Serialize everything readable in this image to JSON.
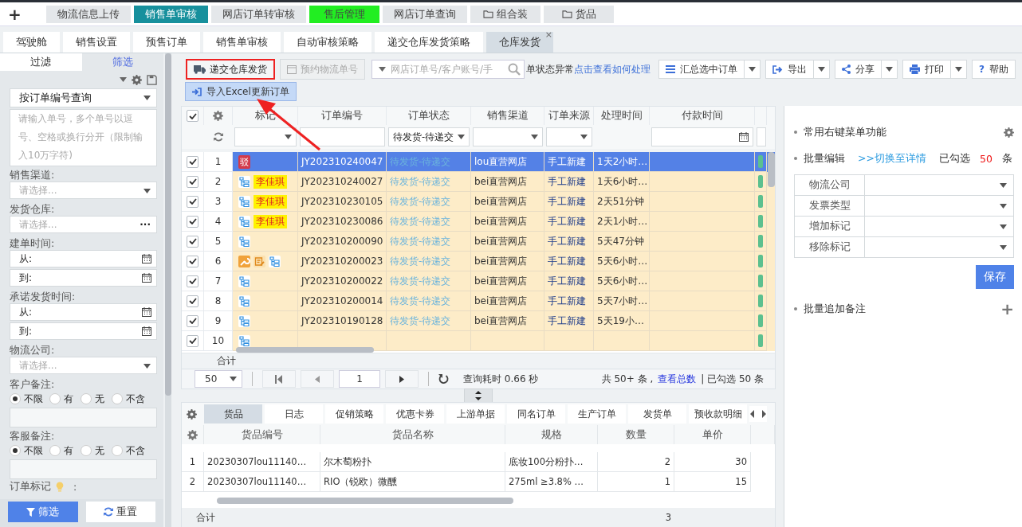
{
  "top_nav": {
    "add_icon": "+",
    "items": [
      {
        "label": "物流信息上传",
        "kind": "tab",
        "selected": false,
        "color": "#e4e7ea"
      },
      {
        "label": "销售单审核",
        "kind": "tab",
        "selected": true,
        "color": "#17909d"
      },
      {
        "label": "网店订单转审核",
        "kind": "tab",
        "selected": false,
        "color": "#e4e7ea"
      },
      {
        "label": "售后管理",
        "kind": "tab",
        "selected": false,
        "color": "#22ee22"
      },
      {
        "label": "网店订单查询",
        "kind": "tab",
        "selected": false,
        "color": "#e4e7ea"
      },
      {
        "label": "组合装",
        "kind": "folder",
        "selected": false,
        "color": "#e4e7ea"
      },
      {
        "label": "货品",
        "kind": "folder",
        "selected": false,
        "color": "#e4e7ea"
      }
    ]
  },
  "page_tabs": [
    {
      "label": "驾驶舱",
      "selected": false
    },
    {
      "label": "销售设置",
      "selected": false
    },
    {
      "label": "预售订单",
      "selected": false
    },
    {
      "label": "销售单审核",
      "selected": false
    },
    {
      "label": "自动审核策略",
      "selected": false
    },
    {
      "label": "递交仓库发货策略",
      "selected": false
    },
    {
      "label": "仓库发货",
      "selected": true,
      "close": "×"
    }
  ],
  "filter_panel": {
    "tabs": [
      {
        "label": "过滤",
        "selected": false
      },
      {
        "label": "筛选",
        "selected": true
      }
    ],
    "query_mode": "按订单编号查询",
    "query_placeholder": "请输入单号，多个单号以逗号、空格或换行分开（限制输入10万字符)",
    "fields": [
      {
        "kind": "select",
        "label": "销售渠道:",
        "placeholder": "请选择..."
      },
      {
        "kind": "picker",
        "label": "发货仓库:",
        "placeholder": "请选择...",
        "symbol": "···"
      },
      {
        "kind": "date_range",
        "label": "建单时间:",
        "from": "从:",
        "to": "到:"
      },
      {
        "kind": "date_range",
        "label": "承诺发货时间:",
        "from": "从:",
        "to": "到:"
      },
      {
        "kind": "select",
        "label": "物流公司:",
        "placeholder": "请选择..."
      },
      {
        "kind": "radio",
        "label": "客户备注:",
        "options": [
          {
            "label": "不限",
            "selected": true
          },
          {
            "label": "有",
            "selected": false
          },
          {
            "label": "无",
            "selected": false
          },
          {
            "label": "不含",
            "selected": false
          }
        ]
      },
      {
        "kind": "radio",
        "label": "客服备注:",
        "options": [
          {
            "label": "不限",
            "selected": true
          },
          {
            "label": "有",
            "selected": false
          },
          {
            "label": "无",
            "selected": false
          },
          {
            "label": "不含",
            "selected": false
          }
        ]
      },
      {
        "kind": "marker",
        "label": "订单标记",
        "suffix": ":"
      }
    ],
    "buttons": [
      {
        "label": "筛选",
        "kind": "primary"
      },
      {
        "label": "重置",
        "kind": "secondary"
      }
    ]
  },
  "toolbar": {
    "primary": [
      {
        "label": "递交仓库发货",
        "disabled": false,
        "highlighted": true
      },
      {
        "label": "预约物流单号",
        "disabled": true,
        "highlighted": false
      }
    ],
    "import_button": "导入Excel更新订单",
    "search": {
      "placeholder": "网店订单号/客户账号/手"
    },
    "notice": "单状态异常",
    "notice_link": "点击查看如何处理",
    "actions": [
      {
        "label": "汇总选中订单",
        "split": true
      },
      {
        "label": "导出",
        "split": true
      },
      {
        "label": "分享",
        "split": true
      },
      {
        "label": "打印",
        "split": true
      },
      {
        "label": "帮助",
        "symbol": "?",
        "split": false
      }
    ]
  },
  "orders": {
    "all_checked": true,
    "columns": [
      {
        "label": "标记",
        "kind": "select"
      },
      {
        "label": "订单编号",
        "kind": "text"
      },
      {
        "label": "订单状态",
        "kind": "select",
        "filter_value": "待发货-待递交"
      },
      {
        "label": "销售渠道",
        "kind": "select"
      },
      {
        "label": "订单来源",
        "kind": "select"
      },
      {
        "label": "处理时间",
        "kind": "none"
      },
      {
        "label": "付款时间",
        "kind": "date"
      },
      {
        "kind": "text"
      }
    ],
    "rows": [
      {
        "no": "1",
        "checked": true,
        "selected": true,
        "marks": [
          {
            "kind": "reject",
            "text": "驳"
          }
        ],
        "order_no": "JY202310240047",
        "status": "待发货-待递交",
        "channel": "lou直营网店",
        "source": "手工新建",
        "time": "1天2小时…"
      },
      {
        "no": "2",
        "checked": true,
        "selected": false,
        "marks": [
          {
            "kind": "tree"
          },
          {
            "kind": "name",
            "text": "李佳琪"
          }
        ],
        "order_no": "JY202310240027",
        "status": "待发货-待递交",
        "channel": "bei直营网店",
        "source": "手工新建",
        "time": "1天6小时…"
      },
      {
        "no": "3",
        "checked": true,
        "selected": false,
        "marks": [
          {
            "kind": "tree"
          },
          {
            "kind": "name",
            "text": "李佳琪"
          }
        ],
        "order_no": "JY202310230105",
        "status": "待发货-待递交",
        "channel": "bei直营网店",
        "source": "手工新建",
        "time": "2天51分钟"
      },
      {
        "no": "4",
        "checked": true,
        "selected": false,
        "marks": [
          {
            "kind": "tree"
          },
          {
            "kind": "name",
            "text": "李佳琪"
          }
        ],
        "order_no": "JY202310230086",
        "status": "待发货-待递交",
        "channel": "bei直营网店",
        "source": "手工新建",
        "time": "2天1小时…"
      },
      {
        "no": "5",
        "checked": true,
        "selected": false,
        "marks": [
          {
            "kind": "tree"
          }
        ],
        "order_no": "JY202310200090",
        "status": "待发货-待递交",
        "channel": "bei直营网店",
        "source": "手工新建",
        "time": "5天47分钟"
      },
      {
        "no": "6",
        "checked": true,
        "selected": false,
        "marks": [
          {
            "kind": "wrench"
          },
          {
            "kind": "edit"
          },
          {
            "kind": "tree"
          }
        ],
        "order_no": "JY202310200023",
        "status": "待发货-待递交",
        "channel": "bei直营网店",
        "source": "手工新建",
        "time": "5天6小时…"
      },
      {
        "no": "7",
        "checked": true,
        "selected": false,
        "marks": [
          {
            "kind": "tree"
          }
        ],
        "order_no": "JY202310200022",
        "status": "待发货-待递交",
        "channel": "bei直营网店",
        "source": "手工新建",
        "time": "5天6小时…"
      },
      {
        "no": "8",
        "checked": true,
        "selected": false,
        "marks": [
          {
            "kind": "tree"
          }
        ],
        "order_no": "JY202310200014",
        "status": "待发货-待递交",
        "channel": "bei直营网店",
        "source": "手工新建",
        "time": "5天7小时…"
      },
      {
        "no": "9",
        "checked": true,
        "selected": false,
        "marks": [
          {
            "kind": "tree"
          }
        ],
        "order_no": "JY202310190128",
        "status": "待发货-待递交",
        "channel": "bei直营网店",
        "source": "手工新建",
        "time": "5天19小…"
      },
      {
        "no": "10",
        "checked": true,
        "selected": false,
        "marks": [
          {
            "kind": "tree"
          }
        ]
      }
    ],
    "sum_label": "合计"
  },
  "pager": {
    "page_size": "50",
    "page": "1",
    "query_time": "查询耗时 0.66 秒",
    "total": "共 50+ 条 ,",
    "total_link": "查看总数",
    "checked": "| 已勾选 50 条"
  },
  "detail": {
    "tabs": [
      {
        "label": "货品",
        "selected": true
      },
      {
        "label": "日志",
        "selected": false
      },
      {
        "label": "促销策略",
        "selected": false
      },
      {
        "label": "优惠卡券",
        "selected": false
      },
      {
        "label": "上游单据",
        "selected": false
      },
      {
        "label": "同名订单",
        "selected": false
      },
      {
        "label": "生产订单",
        "selected": false
      },
      {
        "label": "发货单",
        "selected": false
      },
      {
        "label": "预收款明细",
        "selected": false
      }
    ],
    "columns": [
      "货品编号",
      "货品名称",
      "规格",
      "数量",
      "单价"
    ],
    "rows": [
      {
        "no": "1",
        "code": "20230307lou11140…",
        "name": "尔木萄粉扑",
        "spec": "底妆100分粉扑…",
        "qty": "2",
        "price": "30"
      },
      {
        "no": "2",
        "code": "20230307lou11140…",
        "name": "RIO（锐欧）微醺",
        "spec": "275ml ≥3.8% …",
        "qty": "1",
        "price": "15"
      }
    ],
    "sum": {
      "label": "合计",
      "qty": "3"
    }
  },
  "right_panel": {
    "menu_title": "常用右键菜单功能",
    "batch_edit": "批量编辑",
    "switch_link": ">>切换至详情",
    "checked_prefix": "已勾选",
    "checked_count": "50",
    "checked_suffix": "条",
    "fields": [
      "物流公司",
      "发票类型",
      "增加标记",
      "移除标记"
    ],
    "save": "保存",
    "batch_note": "批量追加备注",
    "add_symbol": "+"
  }
}
